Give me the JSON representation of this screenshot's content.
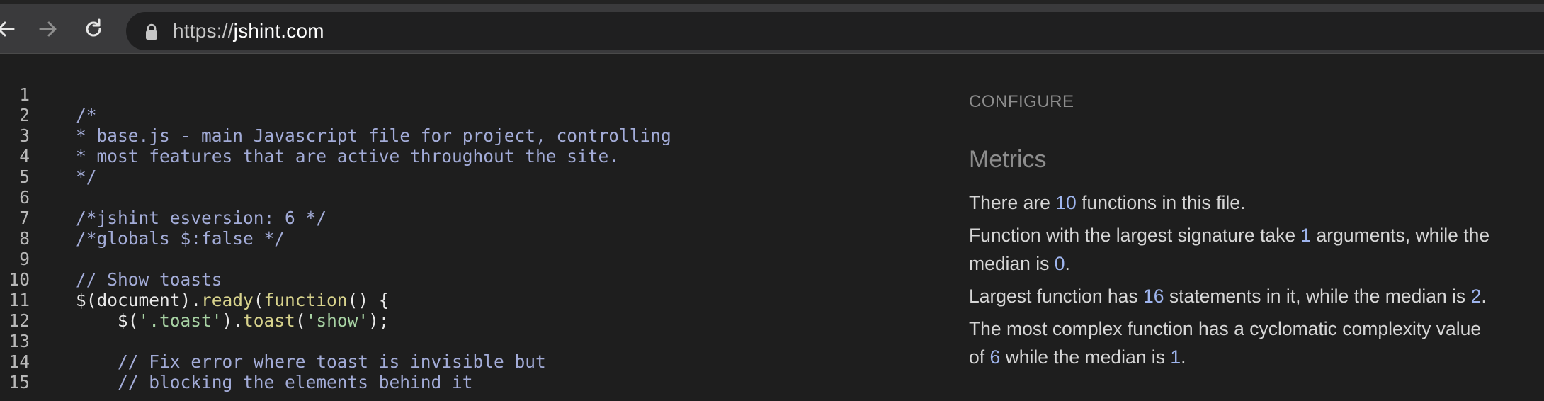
{
  "browser": {
    "url_scheme": "https://",
    "url_host": "jshint.com",
    "icons": [
      "back-arrow-icon",
      "forward-arrow-icon",
      "reload-icon",
      "lock-icon"
    ]
  },
  "editor": {
    "lines": [
      {
        "n": "1",
        "segments": []
      },
      {
        "n": "2",
        "segments": [
          {
            "t": "/*",
            "c": "cm"
          }
        ]
      },
      {
        "n": "3",
        "segments": [
          {
            "t": "* base.js - main Javascript file for project, controlling",
            "c": "cm"
          }
        ]
      },
      {
        "n": "4",
        "segments": [
          {
            "t": "* most features that are active throughout the site.",
            "c": "cm"
          }
        ]
      },
      {
        "n": "5",
        "segments": [
          {
            "t": "*/",
            "c": "cm"
          }
        ]
      },
      {
        "n": "6",
        "segments": []
      },
      {
        "n": "7",
        "segments": [
          {
            "t": "/*jshint esversion: 6 */",
            "c": "cm"
          }
        ]
      },
      {
        "n": "8",
        "segments": [
          {
            "t": "/*globals $:false */",
            "c": "cm"
          }
        ]
      },
      {
        "n": "9",
        "segments": []
      },
      {
        "n": "10",
        "segments": [
          {
            "t": "// Show toasts",
            "c": "cm"
          }
        ]
      },
      {
        "n": "11",
        "segments": [
          {
            "t": "$(document).",
            "c": "plain"
          },
          {
            "t": "ready",
            "c": "fn"
          },
          {
            "t": "(",
            "c": "plain"
          },
          {
            "t": "function",
            "c": "fn"
          },
          {
            "t": "() {",
            "c": "plain"
          }
        ]
      },
      {
        "n": "12",
        "segments": [
          {
            "t": "    $(",
            "c": "plain"
          },
          {
            "t": "'.toast'",
            "c": "str"
          },
          {
            "t": ").",
            "c": "plain"
          },
          {
            "t": "toast",
            "c": "fn"
          },
          {
            "t": "(",
            "c": "plain"
          },
          {
            "t": "'show'",
            "c": "str"
          },
          {
            "t": ");",
            "c": "plain"
          }
        ]
      },
      {
        "n": "13",
        "segments": []
      },
      {
        "n": "14",
        "segments": [
          {
            "t": "    // Fix error where toast is invisible but",
            "c": "cm"
          }
        ]
      },
      {
        "n": "15",
        "segments": [
          {
            "t": "    // blocking the elements behind it",
            "c": "cm"
          }
        ]
      }
    ]
  },
  "panel": {
    "configure_label": "CONFIGURE",
    "metrics_title": "Metrics",
    "metrics": {
      "functions_pre": "There are ",
      "functions_count": "10",
      "functions_post": " functions in this file.",
      "signature_pre": "Function with the largest signature take ",
      "signature_max": "1",
      "signature_mid": " arguments, while the",
      "signature_pre2": "median is ",
      "signature_median": "0",
      "signature_post": ".",
      "largest_pre": "Largest function has ",
      "largest_max": "16",
      "largest_mid": " statements in it, while the median is ",
      "largest_median": "2",
      "largest_post": ".",
      "complex_pre": "The most complex function has a cyclomatic complexity value",
      "complex_pre2": "of ",
      "complex_max": "6",
      "complex_mid": " while the median is ",
      "complex_median": "1",
      "complex_post": "."
    }
  }
}
